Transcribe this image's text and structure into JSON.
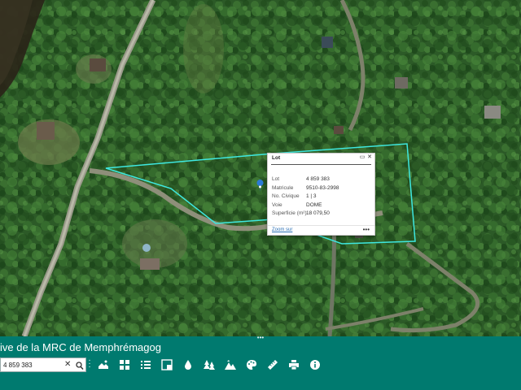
{
  "app": {
    "title": "ive de la MRC de Memphrémagog"
  },
  "search": {
    "value": "4 859 383",
    "clear_glyph": "✕",
    "search_icon": "magnifier-icon"
  },
  "popup": {
    "title": "Lot",
    "maximize_glyph": "▭",
    "close_glyph": "✕",
    "fields": [
      {
        "label": "Lot",
        "value": "4 859 383"
      },
      {
        "label": "Matricule",
        "value": "9510-83-2998"
      },
      {
        "label": "No. Civique",
        "value": "1 | 3"
      },
      {
        "label": "Voie",
        "value": "DOME"
      },
      {
        "label": "Superficie (m²)",
        "value": "18 079,50"
      }
    ],
    "zoom_label": "Zoom sur",
    "more_glyph": "•••"
  },
  "toolbar": {
    "menu_glyph": "⋮",
    "tools": [
      {
        "name": "basemap-gallery-icon"
      },
      {
        "name": "layer-grid-icon"
      },
      {
        "name": "layer-list-icon"
      },
      {
        "name": "overview-map-icon"
      },
      {
        "name": "water-drop-icon"
      },
      {
        "name": "forest-icon"
      },
      {
        "name": "terrain-icon"
      },
      {
        "name": "palette-icon"
      },
      {
        "name": "measure-ruler-icon"
      },
      {
        "name": "print-icon"
      },
      {
        "name": "info-icon"
      }
    ]
  },
  "map": {
    "parcel_outline_color": "#3ee8e0",
    "marker_color": "#2b7bd6"
  }
}
